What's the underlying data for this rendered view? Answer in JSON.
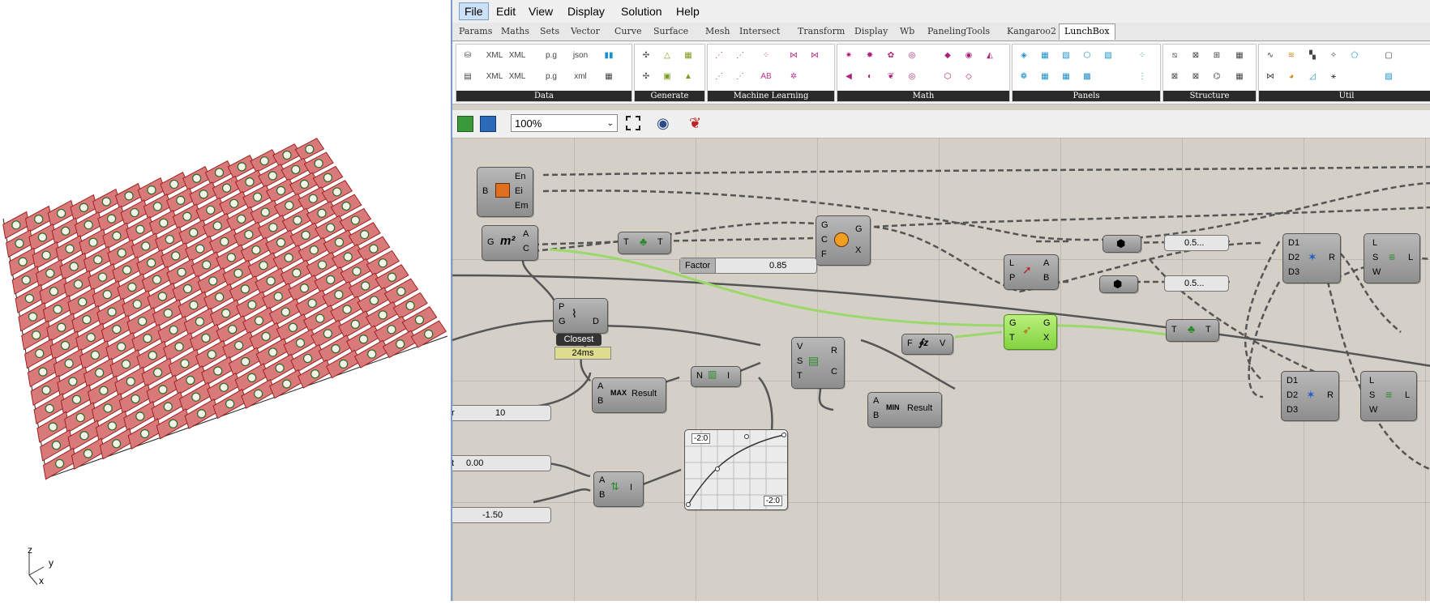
{
  "menubar": {
    "items": [
      "File",
      "Edit",
      "View",
      "Display",
      "Solution",
      "Help"
    ],
    "active": "File"
  },
  "tabs": [
    "Params",
    "Maths",
    "Sets",
    "Vector",
    "Curve",
    "Surface",
    "Mesh",
    "Intersect",
    "Transform",
    "Display",
    "Wb",
    "PanelingTools",
    "Kangaroo2",
    "LunchBox"
  ],
  "active_tab": "LunchBox",
  "ribbon_groups": [
    "Data",
    "Generate",
    "Machine Learning",
    "Math",
    "Panels",
    "Structure",
    "Util"
  ],
  "toolbar2": {
    "zoom": "100%"
  },
  "viewport": {
    "axis_z": "z",
    "axis_y": "y",
    "axis_x": "x"
  },
  "canvas": {
    "node_area_outputs": [
      "En",
      "Ei",
      "Em"
    ],
    "node_area_input": "B",
    "node_mass_input": "G",
    "node_mass_outputs": [
      "A",
      "C"
    ],
    "node_mass_label": "m²",
    "node_graft_in": "T",
    "node_graft_out": "T",
    "node_gcf_inputs": [
      "G",
      "C",
      "F"
    ],
    "node_gcf_outputs": [
      "G",
      "X"
    ],
    "factor_slider": {
      "label": "Factor",
      "value": "0.85"
    },
    "node_lp_inputs": [
      "L",
      "P"
    ],
    "node_lp_outputs": [
      "A",
      "B"
    ],
    "panel1": "0.5...",
    "panel2": "0.5...",
    "closest": {
      "inputs": [
        "P",
        "G"
      ],
      "output": "D",
      "tooltip": "Closest",
      "time": "24ms"
    },
    "slider_10": {
      "value": "10"
    },
    "max_node": {
      "inputs": [
        "A",
        "B"
      ],
      "label": "MAX",
      "output": "Result"
    },
    "bounds_node": {
      "input": "N",
      "output": "I"
    },
    "sub_node": {
      "inputs": [
        "V",
        "S",
        "T"
      ],
      "outputs": [
        "R",
        "C"
      ]
    },
    "fz_node": {
      "input": "F",
      "output": "V"
    },
    "move_node": {
      "inputs": [
        "G",
        "T"
      ],
      "outputs": [
        "G",
        "X"
      ]
    },
    "min_node": {
      "inputs": [
        "A",
        "B"
      ],
      "label": "MIN",
      "output": "Result"
    },
    "graph_node": {
      "top_label": "-2:0",
      "bottom_label": "-2:0"
    },
    "slider_000": {
      "value": "0.00"
    },
    "slider_150": {
      "value": "-1.50"
    },
    "ab_node": {
      "inputs": [
        "A",
        "B"
      ],
      "output": "I"
    },
    "d_node1": {
      "inputs": [
        "D1",
        "D2",
        "D3"
      ],
      "output": "R"
    },
    "d_node2": {
      "inputs": [
        "D1",
        "D2",
        "D3"
      ],
      "output": "R"
    },
    "lsw_node1": {
      "inputs": [
        "L",
        "S",
        "W"
      ],
      "output": "L"
    },
    "lsw_node2": {
      "inputs": [
        "L",
        "S",
        "W"
      ],
      "output": "L"
    },
    "graft2": {
      "in": "T",
      "out": "T"
    },
    "partial_left_labels": [
      "r",
      "t"
    ]
  },
  "colors": {
    "panel_fill": "#d97a7a",
    "panel_edge": "#a02020",
    "canvas_bg": "#d4d0c8",
    "selected_node": "#8fd44a",
    "wire_selected": "#9bd86a"
  }
}
